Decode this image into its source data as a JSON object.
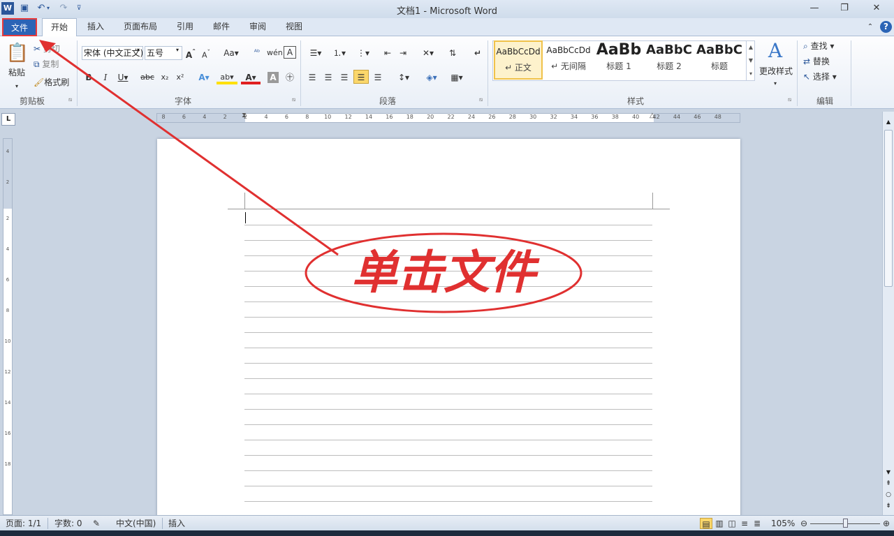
{
  "window": {
    "title": "文档1 - Microsoft Word",
    "minimize_icon": "minimize-icon",
    "restore_icon": "restore-icon",
    "close_icon": "close-icon"
  },
  "quick_access": {
    "app_icon": "word-icon",
    "save_icon": "save-icon",
    "undo_icon": "undo-icon",
    "redo_icon": "redo-icon",
    "customize_icon": "customize-icon"
  },
  "tabs": [
    "文件",
    "开始",
    "插入",
    "页面布局",
    "引用",
    "邮件",
    "审阅",
    "视图"
  ],
  "clipboard": {
    "paste": "粘贴",
    "cut": "剪切",
    "copy": "复制",
    "format_painter": "格式刷",
    "label": "剪贴板"
  },
  "font": {
    "name": "宋体 (中文正文)",
    "size": "五号",
    "label": "字体"
  },
  "paragraph": {
    "label": "段落"
  },
  "styles": {
    "items": [
      {
        "sample": "AaBbCcDd",
        "name": "↵ 正文"
      },
      {
        "sample": "AaBbCcDd",
        "name": "↵ 无间隔"
      },
      {
        "sample": "AaBb",
        "name": "标题 1"
      },
      {
        "sample": "AaBbC",
        "name": "标题 2"
      },
      {
        "sample": "AaBbC",
        "name": "标题"
      }
    ],
    "change_styles": "更改样式",
    "label": "样式"
  },
  "editing": {
    "find": "查找",
    "replace": "替换",
    "select": "选择",
    "label": "编辑"
  },
  "ruler": {
    "ticks": [
      "8",
      "6",
      "4",
      "2",
      "2",
      "4",
      "6",
      "8",
      "10",
      "12",
      "14",
      "16",
      "18",
      "20",
      "22",
      "24",
      "26",
      "28",
      "30",
      "32",
      "34",
      "36",
      "38",
      "40",
      "42",
      "44",
      "46",
      "48"
    ],
    "vticks": [
      "4",
      "2",
      "2",
      "4",
      "6",
      "8",
      "10",
      "12",
      "14",
      "16",
      "18"
    ]
  },
  "annotation": {
    "text": "单击文件",
    "color": "#e03030"
  },
  "status": {
    "page": "页面: 1/1",
    "words": "字数: 0",
    "language": "中文(中国)",
    "mode": "插入",
    "zoom": "105%"
  },
  "colors": {
    "accent": "#2b64b6",
    "highlight_box": "#e83a3a"
  }
}
